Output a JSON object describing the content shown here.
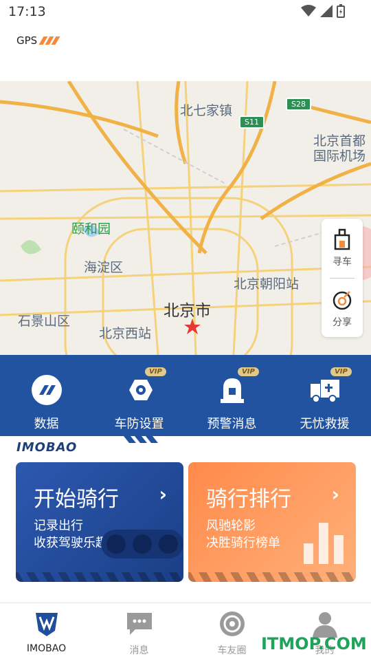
{
  "status_bar": {
    "time": "17:13"
  },
  "header": {
    "gps_label": "GPS"
  },
  "map": {
    "labels": {
      "beiqijia": "北七家镇",
      "capital_airport_1": "北京首都",
      "capital_airport_2": "国际机场",
      "yiheyuan": "颐和园",
      "haidian": "海淀区",
      "chaoyang_station": "北京朝阳站",
      "beijing_city": "北京市",
      "shijingshan": "石景山区",
      "west_station": "北京西站",
      "s11": "S11",
      "s28": "S28"
    }
  },
  "side_panel": {
    "find_car": "寻车",
    "share": "分享"
  },
  "features": [
    {
      "label": "数据",
      "icon": "data-icon",
      "vip": ""
    },
    {
      "label": "车防设置",
      "icon": "security-camera-icon",
      "vip": "VIP"
    },
    {
      "label": "预警消息",
      "icon": "alarm-icon",
      "vip": "VIP"
    },
    {
      "label": "无忧救援",
      "icon": "rescue-truck-icon",
      "vip": "VIP"
    }
  ],
  "brand": "IMOBAO",
  "cards": {
    "start_ride": {
      "title": "开始骑行",
      "line1": "记录出行",
      "line2": "收获驾驶乐趣"
    },
    "ranking": {
      "title": "骑行排行",
      "line1": "风驰轮影",
      "line2": "决胜骑行榜单"
    }
  },
  "tabs": [
    {
      "label": "IMOBAO",
      "icon": "imobao-logo-icon"
    },
    {
      "label": "消息",
      "icon": "message-icon"
    },
    {
      "label": "车友圈",
      "icon": "gear-icon"
    },
    {
      "label": "我的",
      "icon": "profile-icon"
    }
  ],
  "watermark": "ITMOP.COM",
  "colors": {
    "primary": "#2153a0",
    "accent": "#f58a3a"
  }
}
